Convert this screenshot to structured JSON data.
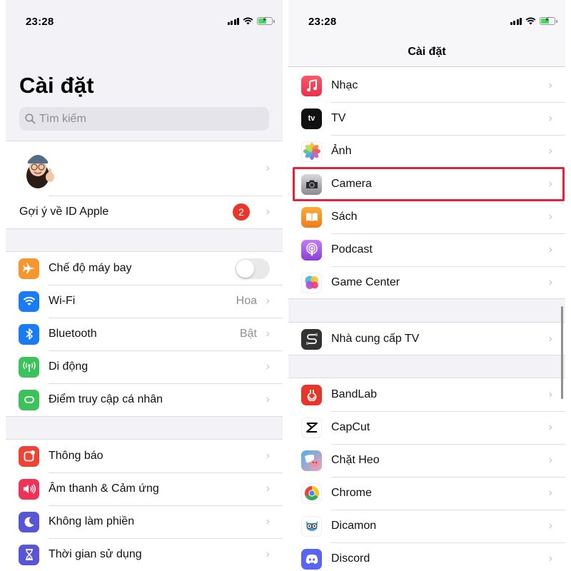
{
  "left": {
    "status": {
      "time": "23:28"
    },
    "title": "Cài đặt",
    "search": {
      "placeholder": "Tìm kiếm"
    },
    "profile": {
      "apple_id_suggestions": "Gợi ý về ID Apple",
      "badge_count": "2"
    },
    "connectivity": [
      {
        "label": "Chế độ máy bay",
        "icon": "airplane-icon",
        "color": "#f7962d",
        "toggle": false
      },
      {
        "label": "Wi-Fi",
        "icon": "wifi-icon",
        "color": "#1a7cf5",
        "value": "Hoa"
      },
      {
        "label": "Bluetooth",
        "icon": "bluetooth-icon",
        "color": "#1a7cf5",
        "value": "Bật"
      },
      {
        "label": "Di động",
        "icon": "cellular-icon",
        "color": "#3cc25b"
      },
      {
        "label": "Điểm truy cập cá nhân",
        "icon": "hotspot-icon",
        "color": "#3cc25b"
      }
    ],
    "system": [
      {
        "label": "Thông báo",
        "icon": "notifications-icon",
        "color": "#ee4433"
      },
      {
        "label": "Âm thanh & Cảm ứng",
        "icon": "sound-icon",
        "color": "#ee3358"
      },
      {
        "label": "Không làm phiền",
        "icon": "moon-icon",
        "color": "#5856d6"
      },
      {
        "label": "Thời gian sử dụng",
        "icon": "hourglass-icon",
        "color": "#5856d6"
      }
    ]
  },
  "right": {
    "status": {
      "time": "23:28"
    },
    "nav_title": "Cài đặt",
    "apple_apps": [
      {
        "label": "Nhạc",
        "icon": "music-icon",
        "color": "#f0475a"
      },
      {
        "label": "TV",
        "icon": "apple-tv-icon",
        "color": "#111111",
        "glyph": "tv"
      },
      {
        "label": "Ảnh",
        "icon": "photos-icon",
        "color": "#ffffff"
      },
      {
        "label": "Camera",
        "icon": "camera-icon",
        "color": "#8e8e93",
        "highlighted": true
      },
      {
        "label": "Sách",
        "icon": "books-icon",
        "color": "#f7901e"
      },
      {
        "label": "Podcast",
        "icon": "podcast-icon",
        "color": "#9a4bdc"
      },
      {
        "label": "Game Center",
        "icon": "game-center-icon",
        "color": "#ffffff"
      }
    ],
    "tv_provider": {
      "label": "Nhà cung cấp TV",
      "icon": "tv-provider-icon",
      "color": "#333333"
    },
    "third_party": [
      {
        "label": "BandLab",
        "icon": "bandlab-icon",
        "color": "#e8352a"
      },
      {
        "label": "CapCut",
        "icon": "capcut-icon",
        "color": "#ffffff"
      },
      {
        "label": "Chặt Heo",
        "icon": "chat-heo-icon",
        "color": "#4aa8e8"
      },
      {
        "label": "Chrome",
        "icon": "chrome-icon",
        "color": "#ffffff"
      },
      {
        "label": "Dicamon",
        "icon": "dicamon-icon",
        "color": "#ffffff"
      },
      {
        "label": "Discord",
        "icon": "discord-icon",
        "color": "#5865f2"
      }
    ],
    "highlight_color": "#e0243f"
  },
  "chevron": "›"
}
